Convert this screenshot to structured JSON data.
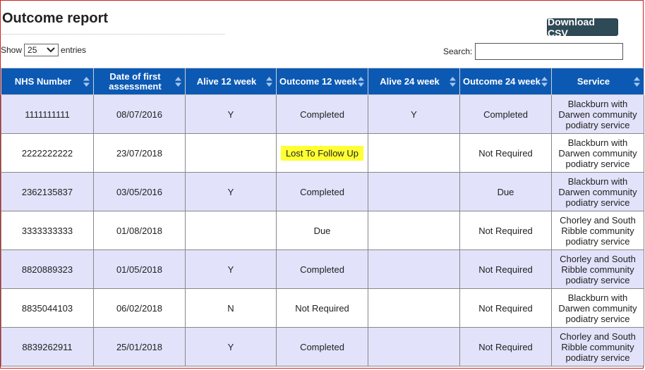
{
  "page": {
    "title": "Outcome report"
  },
  "toolbar": {
    "download_label": "Download CSV"
  },
  "length_menu": {
    "prefix": "Show",
    "selected": "25",
    "suffix": "entries"
  },
  "search": {
    "label": "Search:",
    "value": ""
  },
  "table": {
    "headers": [
      "NHS Number",
      "Date of first assessment",
      "Alive 12 week",
      "Outcome 12 week",
      "Alive 24 week",
      "Outcome 24 week",
      "Service"
    ],
    "rows": [
      {
        "nhs": "1111111111",
        "date": "08/07/2016",
        "alive12": "Y",
        "outcome12": "Completed",
        "alive24": "Y",
        "outcome24": "Completed",
        "service": "Blackburn with Darwen community podiatry service"
      },
      {
        "nhs": "2222222222",
        "date": "23/07/2018",
        "alive12": "",
        "outcome12": "Lost To Follow Up",
        "alive24": "",
        "outcome24": "Not Required",
        "service": "Blackburn with Darwen community podiatry service"
      },
      {
        "nhs": "2362135837",
        "date": "03/05/2016",
        "alive12": "Y",
        "outcome12": "Completed",
        "alive24": "",
        "outcome24": "Due",
        "service": "Blackburn with Darwen community podiatry service"
      },
      {
        "nhs": "3333333333",
        "date": "01/08/2018",
        "alive12": "",
        "outcome12": "Due",
        "alive24": "",
        "outcome24": "Not Required",
        "service": "Chorley and South Ribble community podiatry service"
      },
      {
        "nhs": "8820889323",
        "date": "01/05/2018",
        "alive12": "Y",
        "outcome12": "Completed",
        "alive24": "",
        "outcome24": "Not Required",
        "service": "Chorley and South Ribble community podiatry service"
      },
      {
        "nhs": "8835044103",
        "date": "06/02/2018",
        "alive12": "N",
        "outcome12": "Not Required",
        "alive24": "",
        "outcome24": "Not Required",
        "service": "Blackburn with Darwen community podiatry service"
      },
      {
        "nhs": "8839262911",
        "date": "25/01/2018",
        "alive12": "Y",
        "outcome12": "Completed",
        "alive24": "",
        "outcome24": "Not Required",
        "service": "Chorley and South Ribble community podiatry service"
      }
    ]
  },
  "icons": {
    "sort": "sort-both-icon",
    "dropdown": "chevron-down-icon"
  },
  "colors": {
    "header_bg": "#0c59b4",
    "odd_row": "#e2e2fb",
    "highlight": "#ffff33",
    "button_bg": "#2f4a57"
  }
}
